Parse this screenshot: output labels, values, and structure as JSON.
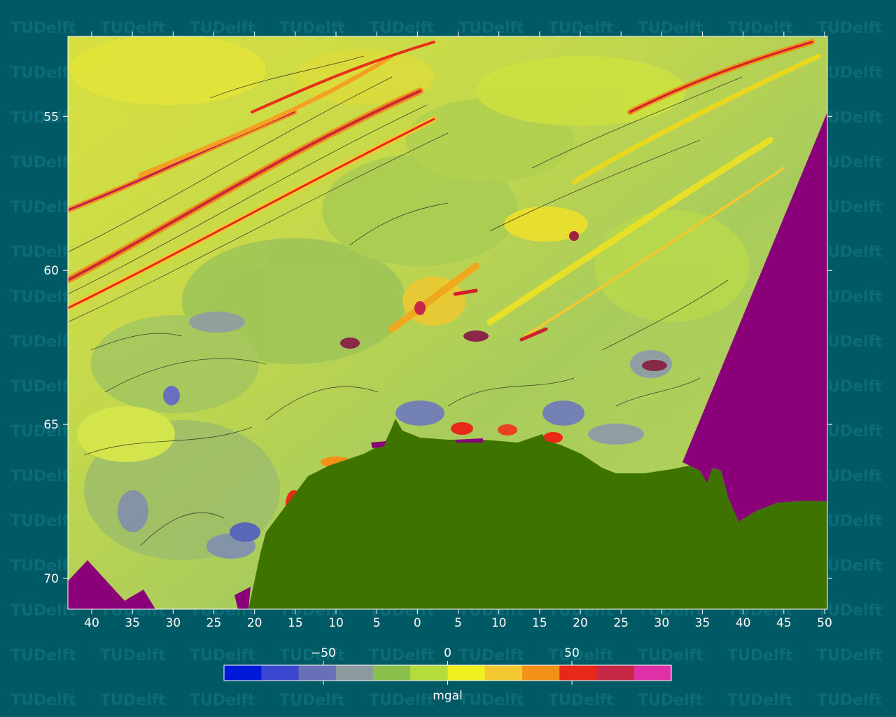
{
  "watermark": {
    "text": "TUDelft",
    "color": "#0b6b76"
  },
  "map": {
    "colors": {
      "land": "#3f7300",
      "nodata": "#8a0078",
      "background": "#005a66"
    },
    "y_axis": {
      "ticks": [
        "55",
        "60",
        "65",
        "70"
      ],
      "ticks_values": [
        55,
        60,
        65,
        70
      ],
      "range": [
        52.4,
        71.0
      ]
    },
    "x_axis": {
      "ticks": [
        "40",
        "35",
        "30",
        "25",
        "20",
        "15",
        "10",
        "5",
        "0",
        "5",
        "10",
        "15",
        "20",
        "25",
        "30",
        "35",
        "40",
        "45",
        "50"
      ]
    }
  },
  "colorbar": {
    "unit": "mgal",
    "range": [
      -90,
      90
    ],
    "tick_labels": [
      "−50",
      "0",
      "50"
    ],
    "tick_values": [
      -50,
      0,
      50
    ],
    "colors": [
      "#0018d8",
      "#3a46d0",
      "#6a70b8",
      "#8c9aa0",
      "#8cc04c",
      "#b4dc3c",
      "#f0f020",
      "#f4c830",
      "#f49018",
      "#e82818",
      "#c82848",
      "#e030a8"
    ]
  }
}
